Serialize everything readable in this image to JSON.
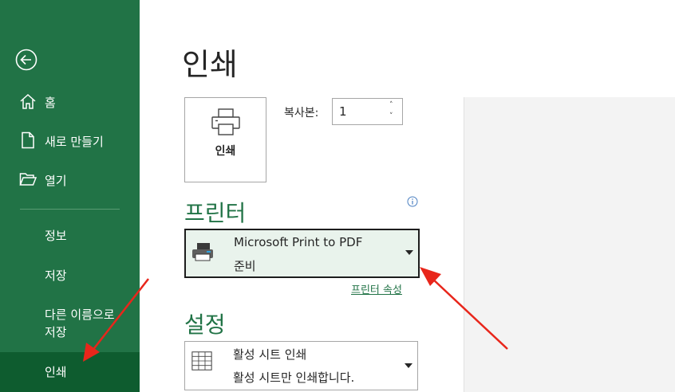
{
  "sidebar": {
    "back_icon": "back-arrow-icon",
    "items": [
      {
        "label": "홈",
        "icon": "home-icon"
      },
      {
        "label": "새로 만들기",
        "icon": "new-document-icon"
      },
      {
        "label": "열기",
        "icon": "folder-open-icon"
      }
    ],
    "text_items": [
      "정보",
      "저장",
      "다른 이름으로\n저장"
    ],
    "active_item": "인쇄"
  },
  "main": {
    "title": "인쇄",
    "print_button_label": "인쇄",
    "copies_label": "복사본:",
    "copies_value": "1",
    "printer_section_title": "프린터",
    "printer": {
      "name": "Microsoft Print to PDF",
      "status": "준비",
      "icon": "printer-icon"
    },
    "printer_properties_link": "프린터 속성",
    "settings_section_title": "설정",
    "print_scope": {
      "title": "활성 시트 인쇄",
      "description": "활성 시트만 인쇄합니다.",
      "icon": "sheet-grid-icon"
    }
  },
  "colors": {
    "sidebar_bg": "#217346",
    "sidebar_active": "#0e5c2f",
    "accent": "#217346",
    "annotation": "#e8261b"
  }
}
